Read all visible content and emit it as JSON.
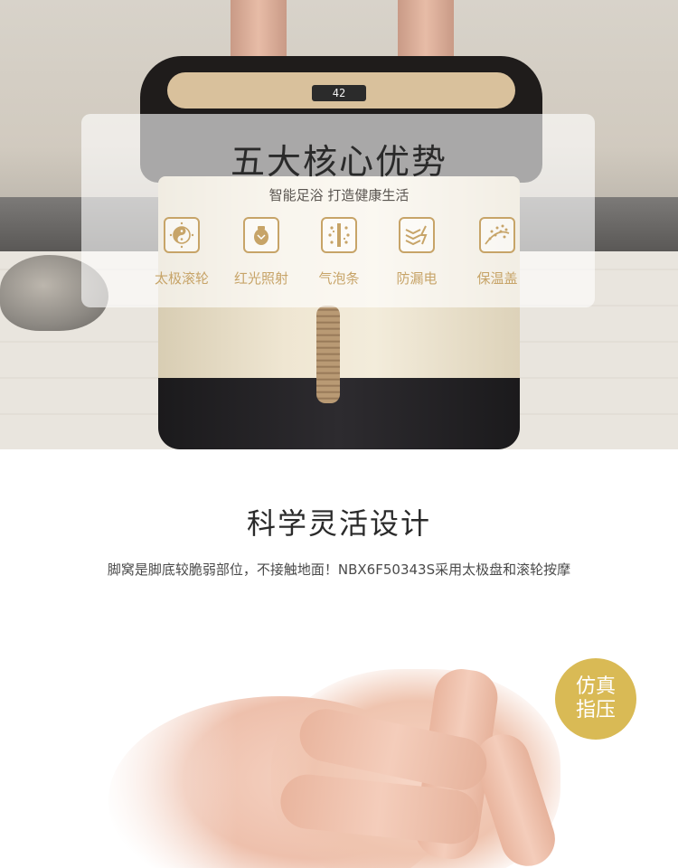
{
  "hero": {
    "display_reading": "42",
    "panel": {
      "title": "五大核心优势",
      "subtitle": "智能足浴 打造健康生活",
      "features": [
        {
          "label": "太极滚轮",
          "icon": "taiji-roller-icon"
        },
        {
          "label": "红光照射",
          "icon": "red-light-icon"
        },
        {
          "label": "气泡条",
          "icon": "bubble-bar-icon"
        },
        {
          "label": "防漏电",
          "icon": "anti-leakage-icon"
        },
        {
          "label": "保温盖",
          "icon": "heat-cover-icon"
        }
      ]
    }
  },
  "section": {
    "title": "科学灵活设计",
    "description": "脚窝是脚底较脆弱部位，不接触地面！NBX6F50343S采用太极盘和滚轮按摩"
  },
  "badge": {
    "line1": "仿真",
    "line2": "指压"
  },
  "colors": {
    "accent_gold": "#c7a468",
    "badge_gold": "#d9ba55",
    "title_dark": "#2a2a2a"
  }
}
